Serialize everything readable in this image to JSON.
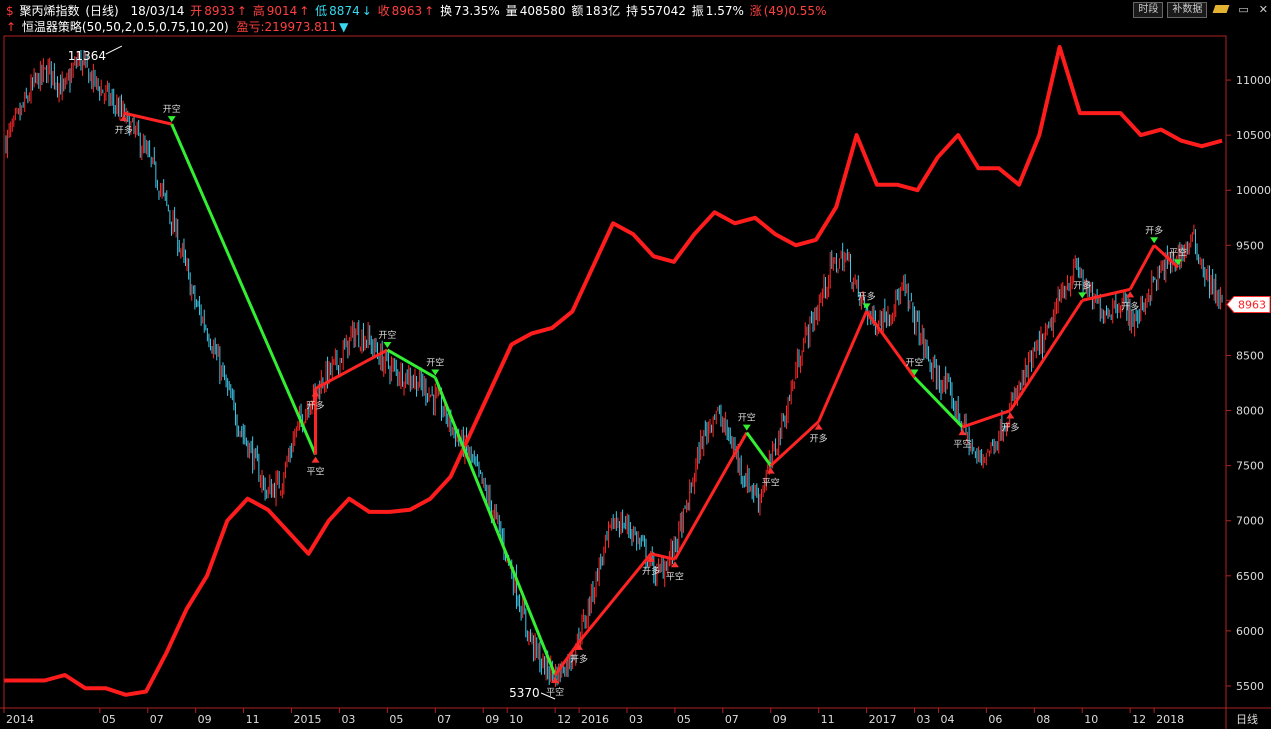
{
  "header": {
    "line1": {
      "icon_text": "$",
      "title": "聚丙烯指数",
      "period": "(日线)",
      "date": "18/03/14",
      "open_label": "开",
      "open": "8933",
      "high_label": "高",
      "high": "9014",
      "low_label": "低",
      "low": "8874",
      "close_label": "收",
      "close": "8963",
      "turnover_label": "换",
      "turnover": "73.35%",
      "volume_label": "量",
      "volume": "408580",
      "amount_label": "额",
      "amount": "183亿",
      "position_label": "持",
      "position": "557042",
      "amplitude_label": "振",
      "amplitude": "1.57%",
      "change_label": "涨",
      "change": "(49)0.55%"
    },
    "line2": {
      "strategy": "恒温器策略(50,50,2,0.5,0.75,10,20)",
      "pnl_label": "盈亏:",
      "pnl": "219973.811"
    },
    "buttons": {
      "time_share": "时段",
      "supplement": "补数据"
    }
  },
  "chart_data": {
    "type": "line",
    "ylim": [
      5300,
      11400
    ],
    "price_ticks": [
      5500,
      6000,
      6500,
      7000,
      7500,
      8000,
      8500,
      9000,
      9500,
      10000,
      10500,
      11000
    ],
    "time_labels": [
      "2014",
      "05",
      "07",
      "09",
      "11",
      "2015",
      "03",
      "05",
      "07",
      "09",
      "10",
      "12",
      "2016",
      "03",
      "05",
      "07",
      "09",
      "11",
      "2017",
      "03",
      "04",
      "06",
      "08",
      "10",
      "12",
      "2018"
    ],
    "axis_period_label": "日线",
    "last_price": "8963",
    "high_mark": "11364",
    "low_mark": "5370",
    "series": [
      {
        "values": [
          10450,
          10700,
          10980,
          11100,
          10900,
          11200,
          11000,
          10850,
          10700,
          10500,
          10250,
          9900,
          9500,
          9000,
          8700,
          8300,
          7900,
          7600,
          7250,
          7350,
          7800,
          8100,
          8300,
          8450,
          8700,
          8650,
          8450,
          8350,
          8300,
          8200,
          8050,
          7800,
          7600,
          7300,
          6950,
          6500,
          6000,
          5700,
          5600,
          5750,
          6100,
          6600,
          7000,
          6950,
          6750,
          6500,
          6700,
          7100,
          7700,
          8000,
          7750,
          7400,
          7200,
          7600,
          8050,
          8600,
          8900,
          9300,
          9400,
          9000,
          8800,
          8900,
          9100,
          8750,
          8350,
          8200,
          7900,
          7550,
          7650,
          7900,
          8200,
          8500,
          8700,
          9100,
          9300,
          9000,
          8900,
          9000,
          8800,
          9100,
          9300,
          9400,
          9550,
          9200,
          8963
        ]
      },
      {
        "values": [
          5550,
          5550,
          5550,
          5600,
          5480,
          5480,
          5420,
          5450,
          5800,
          6200,
          6500,
          7000,
          7200,
          7100,
          6900,
          6700,
          7000,
          7200,
          7080,
          7080,
          7100,
          7200,
          7400,
          7800,
          8200,
          8600,
          8700,
          8750,
          8900,
          9300,
          9700,
          9600,
          9400,
          9350,
          9600,
          9800,
          9700,
          9750,
          9600,
          9500,
          9550,
          9850,
          10500,
          10050,
          10050,
          10000,
          10300,
          10500,
          10200,
          10200,
          10050,
          10500,
          11300,
          10700,
          10700,
          10700,
          10500,
          10550,
          10450,
          10400,
          10450
        ]
      }
    ],
    "trades": [
      {
        "x": "2014-06",
        "y": 10700,
        "type": "buy",
        "label": "开多"
      },
      {
        "x": "2014-08",
        "y": 10600,
        "type": "sell",
        "label": "开空"
      },
      {
        "x": "2015-02",
        "y": 7600,
        "type": "buy",
        "label": "平空"
      },
      {
        "x": "2015-02",
        "y": 8200,
        "type": "buy",
        "label": "开多"
      },
      {
        "x": "2015-05",
        "y": 8550,
        "type": "sell",
        "label": "开空"
      },
      {
        "x": "2015-07",
        "y": 8300,
        "type": "sell",
        "label": "开空"
      },
      {
        "x": "2015-12",
        "y": 5600,
        "type": "buy",
        "label": "平空"
      },
      {
        "x": "2016-01",
        "y": 5900,
        "type": "buy",
        "label": "开多"
      },
      {
        "x": "2016-04",
        "y": 6700,
        "type": "buy",
        "label": "开多"
      },
      {
        "x": "2016-05",
        "y": 6650,
        "type": "buy",
        "label": "平空"
      },
      {
        "x": "2016-08",
        "y": 7800,
        "type": "sell",
        "label": "开空"
      },
      {
        "x": "2016-09",
        "y": 7500,
        "type": "buy",
        "label": "平空"
      },
      {
        "x": "2016-11",
        "y": 7900,
        "type": "buy",
        "label": "开多"
      },
      {
        "x": "2017-01",
        "y": 8900,
        "type": "sell",
        "label": "开多"
      },
      {
        "x": "2017-03",
        "y": 8300,
        "type": "sell",
        "label": "开空"
      },
      {
        "x": "2017-05",
        "y": 7850,
        "type": "buy",
        "label": "平空"
      },
      {
        "x": "2017-07",
        "y": 8000,
        "type": "buy",
        "label": "开多"
      },
      {
        "x": "2017-10",
        "y": 9000,
        "type": "sell",
        "label": "开多"
      },
      {
        "x": "2017-12",
        "y": 9100,
        "type": "buy",
        "label": "开多"
      },
      {
        "x": "2018-01",
        "y": 9500,
        "type": "sell",
        "label": "开多"
      },
      {
        "x": "2018-02",
        "y": 9300,
        "type": "sell",
        "label": "平空"
      }
    ],
    "colors": {
      "up": "#ff2a2a",
      "down": "#40c8e8",
      "equity": "#ff1c1c",
      "short_link": "#33ee33",
      "long_link": "#ff2424",
      "axis": "#b02222",
      "text": "#dcdcdc"
    }
  }
}
